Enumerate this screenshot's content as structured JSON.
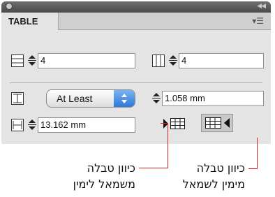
{
  "panel": {
    "tab_label": "TABLE",
    "icons": {
      "close": "close-button-icon",
      "collapse": "collapse-arrows-icon",
      "menu": "panel-menu-icon",
      "rows": "table-rows-icon",
      "columns": "table-columns-icon",
      "row_height": "row-height-icon",
      "column_width": "column-width-icon"
    }
  },
  "rows": {
    "value": "4"
  },
  "columns": {
    "value": "4"
  },
  "row_height": {
    "mode": "At Least",
    "value": "1.058 mm"
  },
  "column_width": {
    "value": "13.162 mm"
  },
  "direction_buttons": {
    "ltr_icon": "ltr-table-direction-icon",
    "rtl_icon": "rtl-table-direction-icon"
  },
  "annotations": {
    "left_line1": "כיוון טבלה",
    "left_line2": "משמאל לימין",
    "right_line1": "כיוון טבלה",
    "right_line2": "מימין לשמאל"
  },
  "colors": {
    "callout": "#e02020",
    "dropdown_accent": "#2c79da"
  }
}
